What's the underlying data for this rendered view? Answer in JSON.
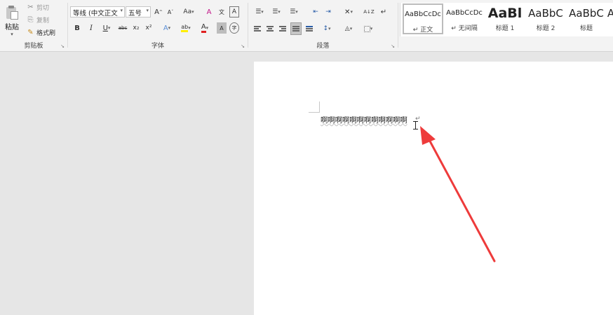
{
  "clipboard": {
    "paste_label": "粘贴",
    "cut_label": "剪切",
    "copy_label": "复制",
    "format_painter_label": "格式刷",
    "group_label": "剪贴板"
  },
  "font": {
    "font_name": "等线 (中文正文",
    "font_size": "五号",
    "grow": "A",
    "shrink": "A",
    "case": "Aa",
    "clear": "A",
    "phonetic": "文",
    "border_char": "A",
    "bold": "B",
    "italic": "I",
    "underline": "U",
    "strike": "abc",
    "subscript": "x₂",
    "superscript": "x²",
    "effects": "A",
    "highlight": "ab",
    "color": "A",
    "shade": "A",
    "enclose": "字",
    "group_label": "字体"
  },
  "paragraph": {
    "sort": "A↓Z",
    "marks": "↵",
    "group_label": "段落"
  },
  "styles": {
    "items": [
      {
        "sample": "AaBbCcDc",
        "name": "↵ 正文"
      },
      {
        "sample": "AaBbCcDc",
        "name": "↵ 无间隔"
      },
      {
        "sample": "AaBl",
        "name": "标题 1"
      },
      {
        "sample": "AaBbC",
        "name": "标题 2"
      },
      {
        "sample": "AaBbC",
        "name": "标题"
      },
      {
        "sample": "A",
        "name": ""
      }
    ]
  },
  "document": {
    "text": "啊啊啊啊啊啊啊啊啊啊啊啊",
    "paragraph_mark": "↵"
  },
  "colors": {
    "arrow": "#ee3b3b",
    "highlight": "#ffee00",
    "font_color": "#e02020"
  }
}
